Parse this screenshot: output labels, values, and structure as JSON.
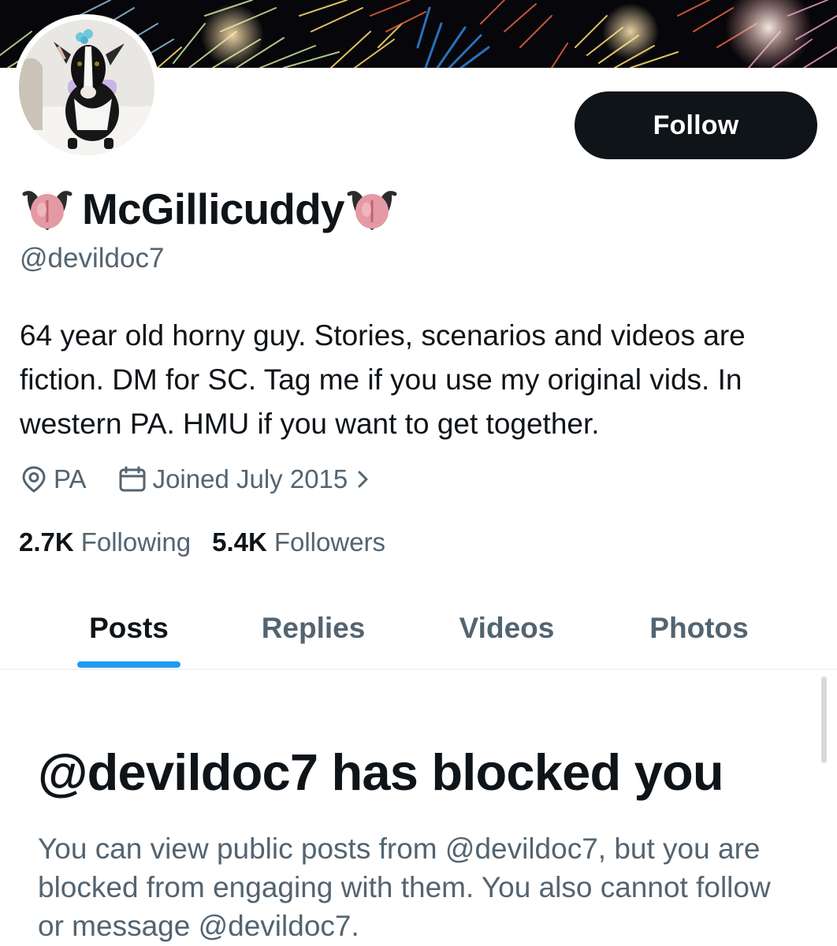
{
  "profile": {
    "display_name": "McGillicuddy",
    "name_emoji": "tongue-devil-emoji",
    "handle": "@devildoc7",
    "bio": "64 year old horny guy. Stories, scenarios and videos are fiction. DM for SC. Tag me if you use my original vids. In western PA. HMU if you want to get together.",
    "location": "PA",
    "joined": "Joined July 2015",
    "follow_label": "Follow"
  },
  "stats": {
    "following_count": "2.7K",
    "following_label": "Following",
    "followers_count": "5.4K",
    "followers_label": "Followers"
  },
  "tabs": [
    {
      "label": "Posts",
      "active": true
    },
    {
      "label": "Replies",
      "active": false
    },
    {
      "label": "Videos",
      "active": false
    },
    {
      "label": "Photos",
      "active": false
    }
  ],
  "blocked": {
    "title": "@devildoc7 has blocked you",
    "message": "You can view public posts from @devildoc7, but you are blocked from engaging with them. You also cannot follow or message @devildoc7."
  },
  "icons": {
    "location": "map-pin-icon",
    "joined": "calendar-icon",
    "chevron": "chevron-right-icon"
  },
  "colors": {
    "primary_text": "#0f1419",
    "secondary_text": "#536471",
    "accent": "#1d9bf0",
    "follow_button": "#0f1419"
  }
}
